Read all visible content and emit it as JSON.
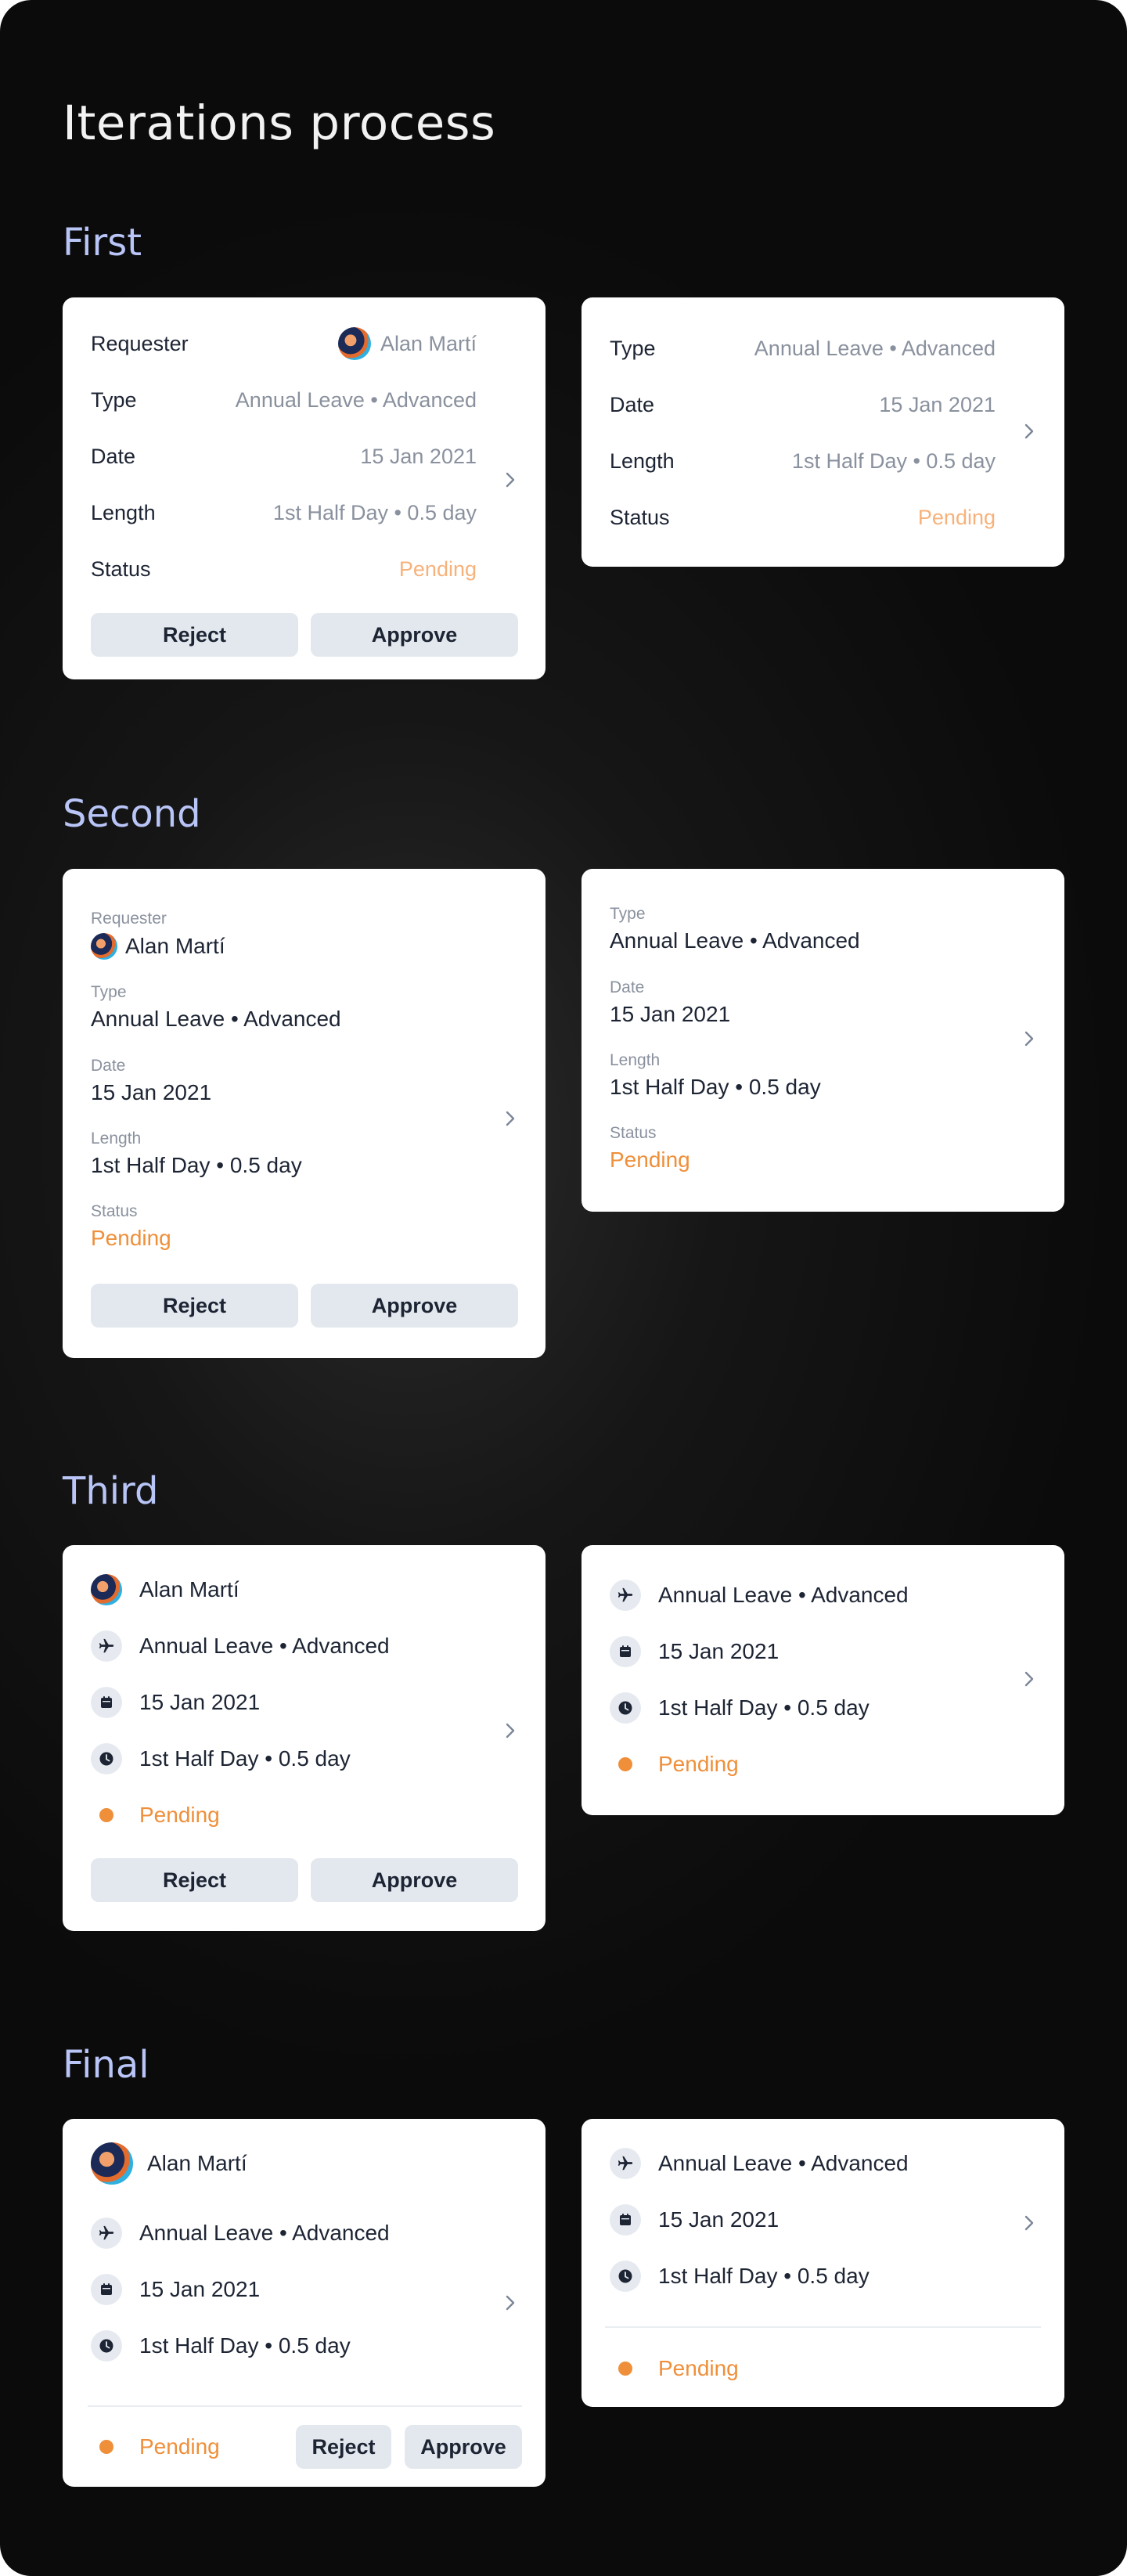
{
  "page_title": "Iterations process",
  "labels": {
    "requester": "Requester",
    "type": "Type",
    "date": "Date",
    "length": "Length",
    "status": "Status"
  },
  "request": {
    "requester": "Alan Martí",
    "type": "Annual Leave • Advanced",
    "date": "15 Jan 2021",
    "length": "1st Half Day • 0.5 day",
    "status": "Pending"
  },
  "actions": {
    "reject": "Reject",
    "approve": "Approve"
  },
  "sections": {
    "first": "First",
    "second": "Second",
    "third": "Third",
    "final": "Final"
  },
  "colors": {
    "pending": "#ef8f3a",
    "pending_light": "#f7b27b",
    "section_title": "#b9c5f7",
    "button_bg": "#e3e8ee"
  },
  "icons": [
    "airplane-icon",
    "calendar-icon",
    "clock-icon",
    "chevron-right-icon"
  ]
}
